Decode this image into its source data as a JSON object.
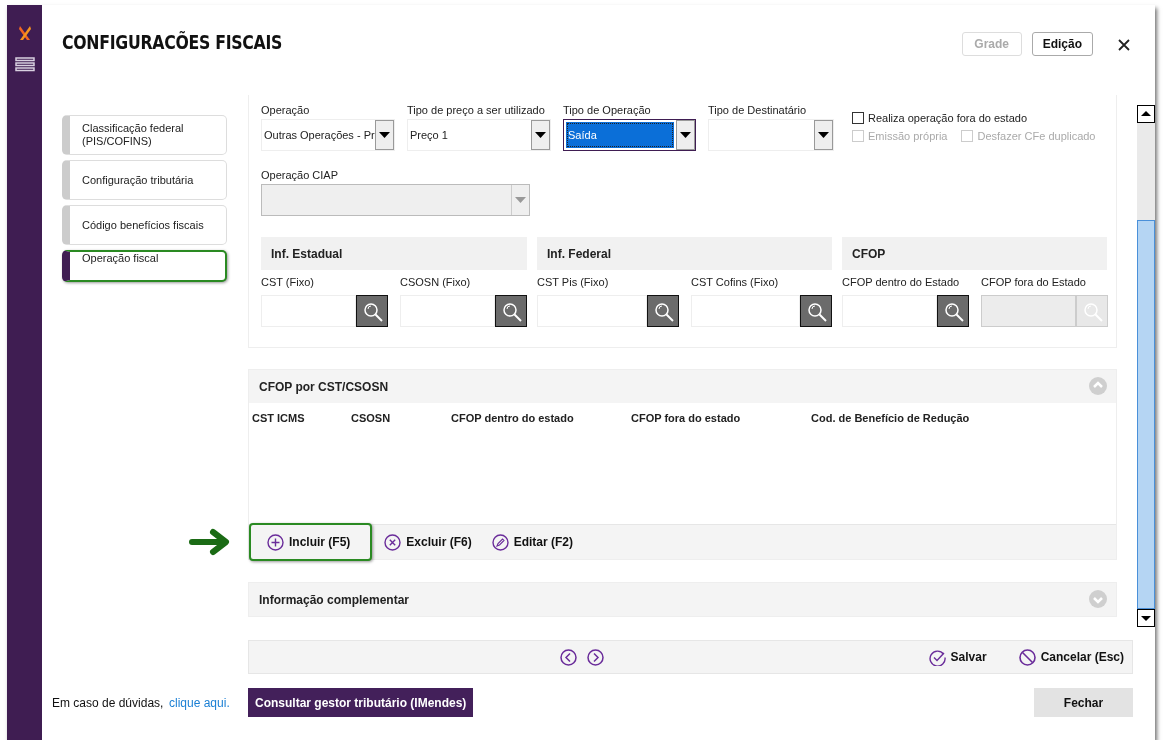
{
  "window": {
    "title": "CONFIGURACÕES FISCAIS"
  },
  "view_buttons": [
    {
      "label": "Grade",
      "disabled": true
    },
    {
      "label": "Edição",
      "disabled": false
    }
  ],
  "sidebar": {
    "items": [
      {
        "label": "Classificação federal (PIS/COFINS)",
        "selected": false,
        "highlighted": false
      },
      {
        "label": "Configuração tributária",
        "selected": false,
        "highlighted": false
      },
      {
        "label": "Código benefícios fiscais",
        "selected": false,
        "highlighted": false
      },
      {
        "label": "Operação fiscal",
        "selected": true,
        "highlighted": true
      }
    ]
  },
  "selects": [
    {
      "label": "Operação",
      "value": "Outras Operações - Pr",
      "focused": false
    },
    {
      "label": "Tipo de preço a ser utilizado",
      "value": "Preço 1",
      "focused": false
    },
    {
      "label": "Tipo de Operação",
      "value": "Saída",
      "focused": true
    },
    {
      "label": "Tipo de Destinatário",
      "focused": false
    }
  ],
  "checkboxes": [
    {
      "label": "Realiza operação fora do estado",
      "checked": false,
      "disabled": false
    },
    {
      "label": "Emissão própria",
      "checked": false,
      "disabled": true
    },
    {
      "label": "Desfazer CFe duplicado",
      "checked": false,
      "disabled": true
    }
  ],
  "ciap": {
    "label": "Operação CIAP",
    "disabled": true
  },
  "groups": [
    {
      "title": "Inf. Estadual",
      "fields": [
        {
          "label": "CST (Fixo)",
          "disabled": false
        },
        {
          "label": "CSOSN (Fixo)",
          "disabled": false
        }
      ]
    },
    {
      "title": "Inf. Federal",
      "fields": [
        {
          "label": "CST Pis (Fixo)",
          "disabled": false
        },
        {
          "label": "CST Cofins (Fixo)",
          "disabled": false
        }
      ]
    },
    {
      "title": "CFOP",
      "fields": [
        {
          "label": "CFOP dentro do Estado",
          "disabled": false
        },
        {
          "label": "CFOP fora do Estado",
          "disabled": true
        }
      ]
    }
  ],
  "cfop_table": {
    "title": "CFOP por CST/CSOSN",
    "expanded": true,
    "columns": [
      "CST ICMS",
      "CSOSN",
      "CFOP dentro do estado",
      "CFOP fora do estado",
      "Cod. de Benefício de Redução"
    ],
    "actions": [
      {
        "label": "Incluir (F5)",
        "kind": "add",
        "highlighted": true
      },
      {
        "label": "Excluir (F6)",
        "kind": "delete",
        "highlighted": false
      },
      {
        "label": "Editar (F2)",
        "kind": "edit",
        "highlighted": false
      }
    ]
  },
  "complement": {
    "title": "Informação complementar",
    "expanded": false
  },
  "nav_actions": [
    {
      "label": "Salvar",
      "kind": "save"
    },
    {
      "label": "Cancelar (Esc)",
      "kind": "cancel"
    }
  ],
  "footer": {
    "help_text": "Em caso de dúvidas,",
    "help_link": "clique aqui.",
    "consult_button": "Consultar gestor tributário (IMendes)",
    "close_button": "Fechar"
  }
}
